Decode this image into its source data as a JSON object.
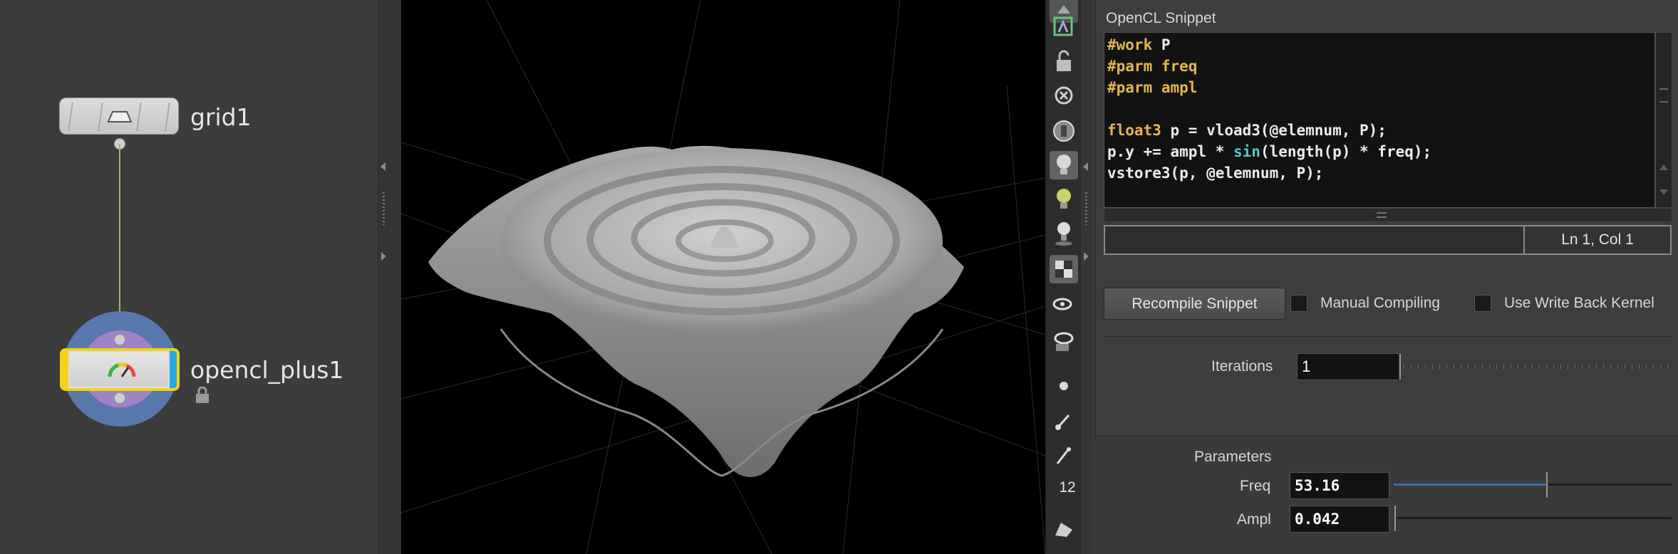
{
  "network": {
    "nodes": [
      {
        "name": "grid1"
      },
      {
        "name": "opencl_plus1"
      }
    ]
  },
  "toolbar": {
    "tools": [
      "select-icon",
      "ghost-icon",
      "lock-icon",
      "close-icon",
      "display-icon",
      "light-icon",
      "light-dim-icon",
      "light-stand-icon",
      "texture-icon",
      "eyedrop-icon",
      "eye-icon",
      "dot-icon",
      "brush-icon",
      "pin-icon",
      "number-icon",
      "pen-icon"
    ],
    "number_label": "12"
  },
  "params": {
    "snippet_label": "OpenCL Snippet",
    "code_lines": [
      [
        {
          "t": "#work ",
          "c": "kw"
        },
        {
          "t": "P",
          "c": ""
        }
      ],
      [
        {
          "t": "#parm ",
          "c": "kw"
        },
        {
          "t": "freq",
          "c": "kw"
        }
      ],
      [
        {
          "t": "#parm ",
          "c": "kw"
        },
        {
          "t": "ampl",
          "c": "kw"
        }
      ],
      [
        {
          "t": "",
          "c": ""
        }
      ],
      [
        {
          "t": "float3",
          "c": "kw"
        },
        {
          "t": " p = vload3(@elemnum, P);",
          "c": ""
        }
      ],
      [
        {
          "t": "p.y += ampl * ",
          "c": ""
        },
        {
          "t": "sin",
          "c": "fn"
        },
        {
          "t": "(length(p) * freq);",
          "c": ""
        }
      ],
      [
        {
          "t": "vstore3(p, @elemnum, P);",
          "c": ""
        }
      ]
    ],
    "cursor_pos": "Ln 1, Col 1",
    "recompile_label": "Recompile Snippet",
    "manual_compiling_label": "Manual Compiling",
    "write_back_label": "Use Write Back Kernel",
    "iterations_label": "Iterations",
    "iterations_value": "1",
    "parameters_label": "Parameters",
    "freq_label": "Freq",
    "freq_value": "53.16",
    "freq_slider_fraction": 0.55,
    "ampl_label": "Ampl",
    "ampl_value": "0.042"
  },
  "colors": {
    "accent_yellow": "#f2d21a",
    "accent_blue": "#2aa6e2",
    "keyword": "#e5b553",
    "function": "#5bc3c3"
  }
}
